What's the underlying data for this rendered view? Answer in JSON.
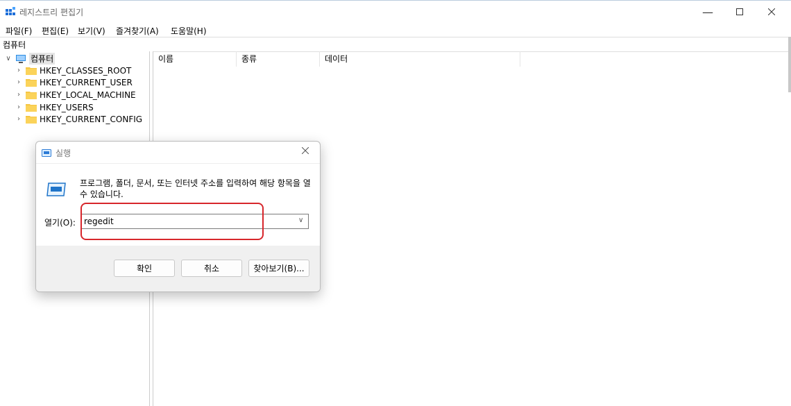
{
  "window": {
    "title": "레지스트리 편집기"
  },
  "menu": [
    "파일(F)",
    "편집(E)",
    "보기(V)",
    "즐겨찾기(A)",
    "도움말(H)"
  ],
  "address": "컴퓨터",
  "tree": {
    "root": "컴퓨터",
    "children": [
      "HKEY_CLASSES_ROOT",
      "HKEY_CURRENT_USER",
      "HKEY_LOCAL_MACHINE",
      "HKEY_USERS",
      "HKEY_CURRENT_CONFIG"
    ]
  },
  "columns": [
    "이름",
    "종류",
    "데이터"
  ],
  "run_dialog": {
    "title": "실행",
    "description": "프로그램, 폴더, 문서, 또는 인터넷 주소를 입력하여 해당 항목을 열 수 있습니다.",
    "open_label": "열기(O):",
    "input_value": "regedit",
    "ok_label": "확인",
    "cancel_label": "취소",
    "browse_label": "찾아보기(B)..."
  },
  "colors": {
    "highlight": "#d7262b",
    "folder": "#f5c542",
    "selection": "#e5e5e5"
  },
  "icons": [
    "registry-editor-icon",
    "minimize-icon",
    "maximize-icon",
    "close-icon",
    "computer-icon",
    "folder-icon",
    "chevron-right-icon",
    "chevron-down-icon",
    "run-icon"
  ]
}
